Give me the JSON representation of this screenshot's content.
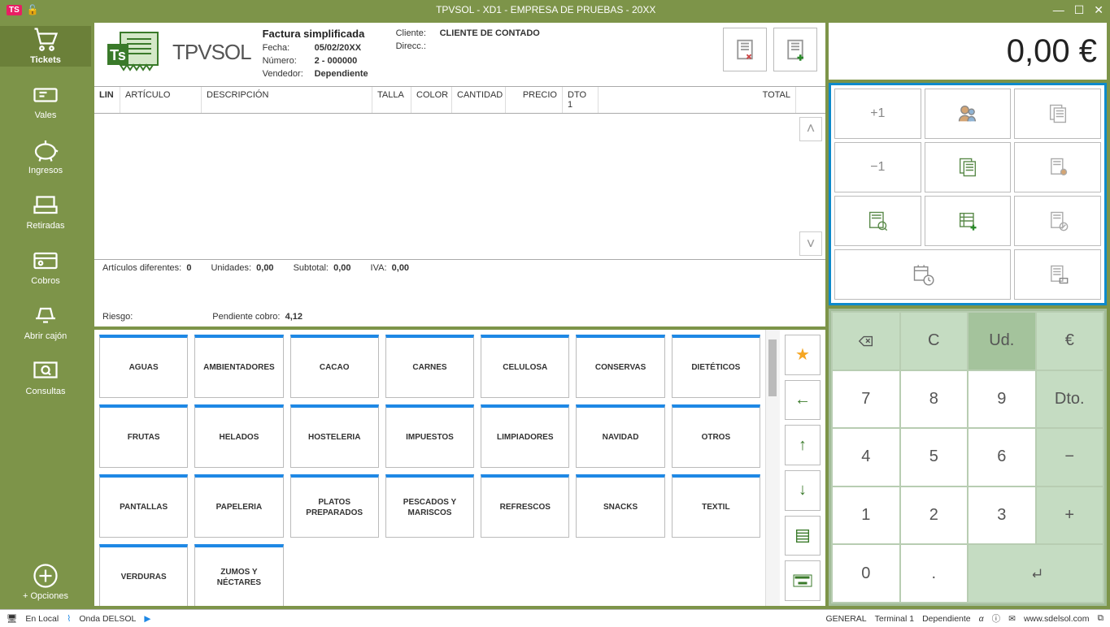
{
  "titlebar": {
    "title": "TPVSOL - XD1 - EMPRESA DE PRUEBAS - 20XX"
  },
  "sidebar": {
    "items": [
      {
        "label": "Tickets"
      },
      {
        "label": "Vales"
      },
      {
        "label": "Ingresos"
      },
      {
        "label": "Retiradas"
      },
      {
        "label": "Cobros"
      },
      {
        "label": "Abrir cajón"
      },
      {
        "label": "Consultas"
      }
    ],
    "options_label": "+ Opciones"
  },
  "invoice": {
    "logo_text": "TPVSOL",
    "title": "Factura simplificada",
    "date_label": "Fecha:",
    "date_value": "05/02/20XX",
    "number_label": "Número:",
    "number_value": "2 - 000000",
    "vendor_label": "Vendedor:",
    "vendor_value": "Dependiente",
    "client_label": "Cliente:",
    "client_value": "CLIENTE DE CONTADO",
    "address_label": "Direcc.:"
  },
  "grid": {
    "headers": {
      "lin": "LIN",
      "articulo": "ARTÍCULO",
      "descripcion": "DESCRIPCIÓN",
      "talla": "TALLA",
      "color": "COLOR",
      "cantidad": "CANTIDAD",
      "precio": "PRECIO",
      "dto1": "DTO 1",
      "total": "TOTAL"
    },
    "footer": {
      "art_dif_label": "Artículos diferentes:",
      "art_dif_value": "0",
      "unidades_label": "Unidades:",
      "unidades_value": "0,00",
      "subtotal_label": "Subtotal:",
      "subtotal_value": "0,00",
      "iva_label": "IVA:",
      "iva_value": "0,00",
      "riesgo_label": "Riesgo:",
      "pendiente_label": "Pendiente cobro:",
      "pendiente_value": "4,12"
    }
  },
  "categories": [
    "AGUAS",
    "AMBIENTADORES",
    "CACAO",
    "CARNES",
    "CELULOSA",
    "CONSERVAS",
    "DIETÉTICOS",
    "FRUTAS",
    "HELADOS",
    "HOSTELERIA",
    "IMPUESTOS",
    "LIMPIADORES",
    "NAVIDAD",
    "OTROS",
    "PANTALLAS",
    "PAPELERIA",
    "PLATOS PREPARADOS",
    "PESCADOS Y MARISCOS",
    "REFRESCOS",
    "SNACKS",
    "TEXTIL",
    "VERDURAS",
    "ZUMOS Y NÉCTARES"
  ],
  "total": "0,00 €",
  "action_grid": {
    "plus1": "+1",
    "minus1": "−1"
  },
  "keypad": {
    "ud": "Ud.",
    "euro": "€",
    "c": "C",
    "dto": "Dto.",
    "k7": "7",
    "k8": "8",
    "k9": "9",
    "k4": "4",
    "k5": "5",
    "k6": "6",
    "k1": "1",
    "k2": "2",
    "k3": "3",
    "k0": "0",
    "dot": ".",
    "minus": "−",
    "plus": "+"
  },
  "statusbar": {
    "local": "En Local",
    "onda": "Onda DELSOL",
    "general": "GENERAL",
    "terminal": "Terminal 1",
    "user": "Dependiente",
    "url": "www.sdelsol.com"
  }
}
